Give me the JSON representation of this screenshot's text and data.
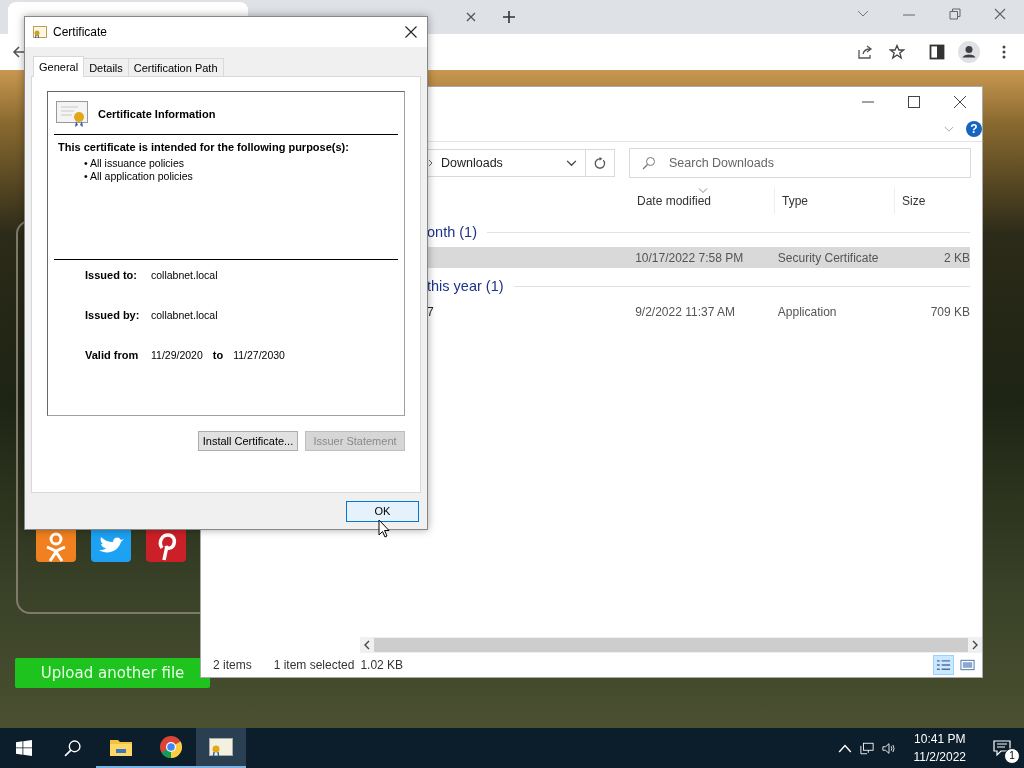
{
  "webpage": {
    "upload_button": "Upload another file"
  },
  "explorer": {
    "help": "?",
    "address": "Downloads",
    "search_placeholder": "Search Downloads",
    "columns": [
      "Date modified",
      "Type",
      "Size"
    ],
    "groups": [
      {
        "label": "onth (1)",
        "rows": [
          {
            "date": "10/17/2022 7:58 PM",
            "type": "Security Certificate",
            "size": "2 KB",
            "selected": true
          }
        ]
      },
      {
        "label": "this year (1)",
        "rows": [
          {
            "name": "7",
            "date": "9/2/2022 11:37 AM",
            "type": "Application",
            "size": "709 KB",
            "selected": false
          }
        ]
      }
    ],
    "status": {
      "items": "2 items",
      "selection": "1 item selected",
      "size": "1.02 KB"
    },
    "views": [
      {
        "kind": "details",
        "selected": true
      },
      {
        "kind": "thumbnails",
        "selected": false
      }
    ]
  },
  "certificate": {
    "title": "Certificate",
    "tabs": [
      {
        "label": "General",
        "selected": true
      },
      {
        "label": "Details",
        "selected": false
      },
      {
        "label": "Certification Path",
        "selected": false
      }
    ],
    "heading": "Certificate Information",
    "purpose_title": "This certificate is intended for the following purpose(s):",
    "purposes": [
      "• All issuance policies",
      "• All application policies"
    ],
    "issued_to": {
      "label": "Issued to:",
      "value": "collabnet.local"
    },
    "issued_by": {
      "label": "Issued by:",
      "value": "collabnet.local"
    },
    "validity": {
      "label": "Valid from",
      "from": "11/29/2020",
      "to_label": "to",
      "to": "11/27/2030"
    },
    "buttons": [
      {
        "label": "Install Certificate...",
        "disabled": false
      },
      {
        "label": "Issuer Statement",
        "disabled": true
      }
    ],
    "ok": "OK"
  },
  "taskbar": {
    "apps": [
      {
        "kind": "folder",
        "running": true,
        "active": false
      },
      {
        "kind": "chrome",
        "running": true,
        "active": false
      },
      {
        "kind": "certificate",
        "running": true,
        "active": true
      }
    ],
    "time": "10:41 PM",
    "date": "11/2/2022",
    "notifications": "1"
  }
}
